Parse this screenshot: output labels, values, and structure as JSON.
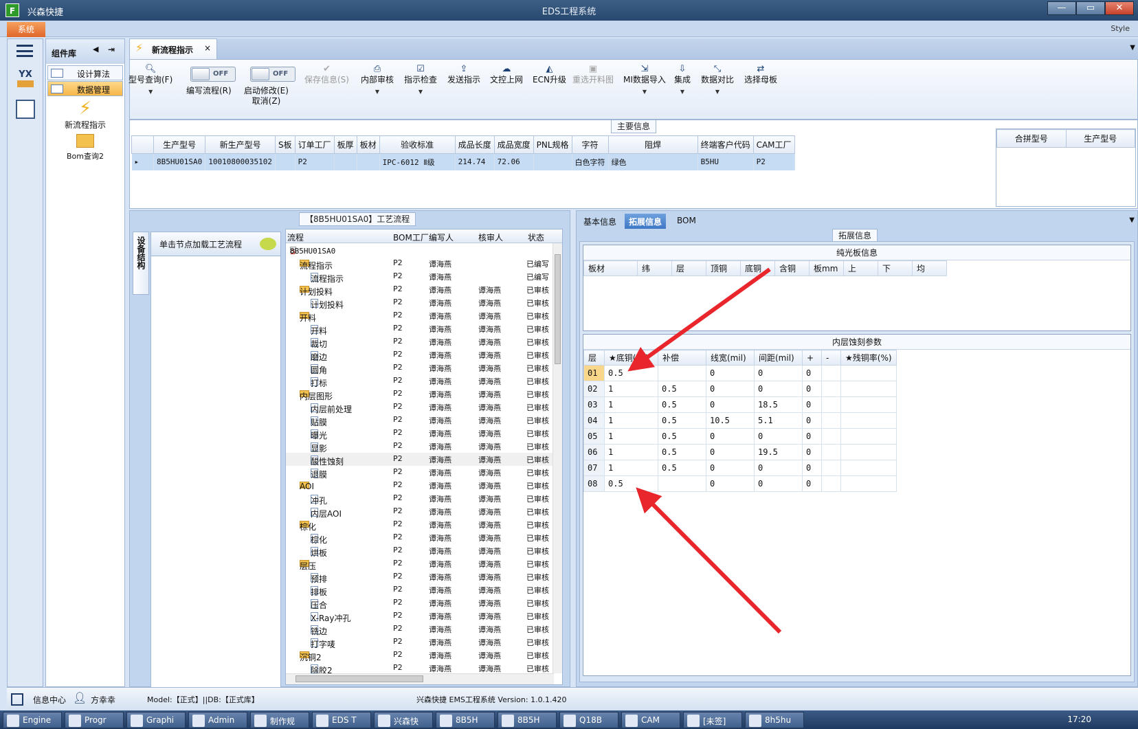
{
  "window": {
    "app_icon": "F",
    "app_name": "兴森快捷",
    "title": "EDS工程系统",
    "buttons": {
      "min": "—",
      "max": "▭",
      "close": "✕"
    }
  },
  "menu": {
    "system": "系统",
    "style": "Style"
  },
  "component_lib": {
    "title": "组件库",
    "items": [
      "设计算法",
      "数据管理"
    ],
    "tiles": [
      "新流程指示",
      "Bom查询2"
    ]
  },
  "doc_tab": {
    "label": "新流程指示",
    "close": "×"
  },
  "ribbon": {
    "query": "型号查询(F)",
    "write_flow": "编写流程(R)",
    "toggle_off": "OFF",
    "start_modify": "启动修改(E)",
    "cancel": "取消(Z)",
    "save": "保存信息(S)",
    "internal_review": "内部审核",
    "instruction_check": "指示检查",
    "send_instruction": "发送指示",
    "upload": "文控上网",
    "ecn": "ECN升级",
    "reselect": "重选开料图",
    "mi_import": "MI数据导入",
    "integrate": "集成",
    "compare": "数据对比",
    "mother_board": "选择母板"
  },
  "main_info": {
    "caption": "主要信息",
    "columns": [
      "生产型号",
      "新生产型号",
      "S板",
      "订单工厂",
      "板厚",
      "板材",
      "验收标准",
      "成品长度",
      "成品宽度",
      "PNL规格",
      "字符",
      "阻焊",
      "终端客户代码",
      "CAM工厂"
    ],
    "row": [
      "8B5HU01SA0",
      "10010800035102",
      "",
      "P2",
      "",
      "",
      "IPC-6012 Ⅱ级",
      "214.74",
      "72.06",
      "",
      "白色字符",
      "绿色",
      "B5HU",
      "P2"
    ],
    "side_columns": [
      "合拼型号",
      "生产型号"
    ]
  },
  "flow_panel": {
    "caption": "【8B5HU01SA0】工艺流程",
    "vertical_tab": "设备结构",
    "load_hint": "单击节点加载工艺流程",
    "headers": [
      "流程",
      "BOM工厂",
      "编写人",
      "核审人",
      "状态"
    ],
    "root": "8B5HU01SA0",
    "rows": [
      {
        "name": "流程指示",
        "level": 1,
        "folder": true,
        "bom": "P2",
        "writer": "谭海燕",
        "reviewer": "",
        "status": "已编写"
      },
      {
        "name": "流程指示",
        "level": 2,
        "folder": false,
        "bom": "P2",
        "writer": "谭海燕",
        "reviewer": "",
        "status": "已编写"
      },
      {
        "name": "计划投料",
        "level": 1,
        "folder": true,
        "bom": "P2",
        "writer": "谭海燕",
        "reviewer": "谭海燕",
        "status": "已审核"
      },
      {
        "name": "计划投料",
        "level": 2,
        "folder": false,
        "bom": "P2",
        "writer": "谭海燕",
        "reviewer": "谭海燕",
        "status": "已审核"
      },
      {
        "name": "开料",
        "level": 1,
        "folder": true,
        "bom": "P2",
        "writer": "谭海燕",
        "reviewer": "谭海燕",
        "status": "已审核"
      },
      {
        "name": "开料",
        "level": 2,
        "folder": false,
        "bom": "P2",
        "writer": "谭海燕",
        "reviewer": "谭海燕",
        "status": "已审核"
      },
      {
        "name": "裁切",
        "level": 2,
        "folder": false,
        "bom": "P2",
        "writer": "谭海燕",
        "reviewer": "谭海燕",
        "status": "已审核"
      },
      {
        "name": "磨边",
        "level": 2,
        "folder": false,
        "bom": "P2",
        "writer": "谭海燕",
        "reviewer": "谭海燕",
        "status": "已审核"
      },
      {
        "name": "圆角",
        "level": 2,
        "folder": false,
        "bom": "P2",
        "writer": "谭海燕",
        "reviewer": "谭海燕",
        "status": "已审核"
      },
      {
        "name": "打标",
        "level": 2,
        "folder": false,
        "bom": "P2",
        "writer": "谭海燕",
        "reviewer": "谭海燕",
        "status": "已审核"
      },
      {
        "name": "内层图形",
        "level": 1,
        "folder": true,
        "bom": "P2",
        "writer": "谭海燕",
        "reviewer": "谭海燕",
        "status": "已审核"
      },
      {
        "name": "内层前处理",
        "level": 2,
        "folder": false,
        "bom": "P2",
        "writer": "谭海燕",
        "reviewer": "谭海燕",
        "status": "已审核"
      },
      {
        "name": "贴膜",
        "level": 2,
        "folder": false,
        "bom": "P2",
        "writer": "谭海燕",
        "reviewer": "谭海燕",
        "status": "已审核"
      },
      {
        "name": "曝光",
        "level": 2,
        "folder": false,
        "bom": "P2",
        "writer": "谭海燕",
        "reviewer": "谭海燕",
        "status": "已审核"
      },
      {
        "name": "显影",
        "level": 2,
        "folder": false,
        "bom": "P2",
        "writer": "谭海燕",
        "reviewer": "谭海燕",
        "status": "已审核"
      },
      {
        "name": "酸性蚀刻",
        "level": 2,
        "folder": false,
        "bom": "P2",
        "writer": "谭海燕",
        "reviewer": "谭海燕",
        "status": "已审核",
        "highlight": true
      },
      {
        "name": "退膜",
        "level": 2,
        "folder": false,
        "bom": "P2",
        "writer": "谭海燕",
        "reviewer": "谭海燕",
        "status": "已审核"
      },
      {
        "name": "AOI",
        "level": 1,
        "folder": true,
        "bom": "P2",
        "writer": "谭海燕",
        "reviewer": "谭海燕",
        "status": "已审核"
      },
      {
        "name": "冲孔",
        "level": 2,
        "folder": false,
        "bom": "P2",
        "writer": "谭海燕",
        "reviewer": "谭海燕",
        "status": "已审核"
      },
      {
        "name": "内层AOI",
        "level": 2,
        "folder": false,
        "bom": "P2",
        "writer": "谭海燕",
        "reviewer": "谭海燕",
        "status": "已审核"
      },
      {
        "name": "棕化",
        "level": 1,
        "folder": true,
        "bom": "P2",
        "writer": "谭海燕",
        "reviewer": "谭海燕",
        "status": "已审核"
      },
      {
        "name": "棕化",
        "level": 2,
        "folder": false,
        "bom": "P2",
        "writer": "谭海燕",
        "reviewer": "谭海燕",
        "status": "已审核"
      },
      {
        "name": "烘板",
        "level": 2,
        "folder": false,
        "bom": "P2",
        "writer": "谭海燕",
        "reviewer": "谭海燕",
        "status": "已审核"
      },
      {
        "name": "层压",
        "level": 1,
        "folder": true,
        "bom": "P2",
        "writer": "谭海燕",
        "reviewer": "谭海燕",
        "status": "已审核"
      },
      {
        "name": "预排",
        "level": 2,
        "folder": false,
        "bom": "P2",
        "writer": "谭海燕",
        "reviewer": "谭海燕",
        "status": "已审核"
      },
      {
        "name": "排板",
        "level": 2,
        "folder": false,
        "bom": "P2",
        "writer": "谭海燕",
        "reviewer": "谭海燕",
        "status": "已审核"
      },
      {
        "name": "压合",
        "level": 2,
        "folder": false,
        "bom": "P2",
        "writer": "谭海燕",
        "reviewer": "谭海燕",
        "status": "已审核"
      },
      {
        "name": "X-Ray冲孔",
        "level": 2,
        "folder": false,
        "bom": "P2",
        "writer": "谭海燕",
        "reviewer": "谭海燕",
        "status": "已审核"
      },
      {
        "name": "铣边",
        "level": 2,
        "folder": false,
        "bom": "P2",
        "writer": "谭海燕",
        "reviewer": "谭海燕",
        "status": "已审核"
      },
      {
        "name": "打字唛",
        "level": 2,
        "folder": false,
        "bom": "P2",
        "writer": "谭海燕",
        "reviewer": "谭海燕",
        "status": "已审核"
      },
      {
        "name": "沉铜2",
        "level": 1,
        "folder": true,
        "bom": "P2",
        "writer": "谭海燕",
        "reviewer": "谭海燕",
        "status": "已审核"
      },
      {
        "name": "除胶2",
        "level": 2,
        "folder": false,
        "bom": "P2",
        "writer": "谭海燕",
        "reviewer": "谭海燕",
        "status": "已审核"
      }
    ]
  },
  "right_tabs": [
    "基本信息",
    "拓展信息",
    "BOM"
  ],
  "ext_info": {
    "caption": "拓展信息",
    "plain_board": {
      "title": "纯光板信息",
      "columns": [
        "板材",
        "纬",
        "层",
        "顶铜",
        "底铜",
        "含铜",
        "板mm",
        "上",
        "下",
        "均"
      ]
    },
    "inner_etch": {
      "title": "内层蚀刻参数",
      "columns": [
        "层",
        "★底铜(oz)",
        "补偿",
        "线宽(mil)",
        "间距(mil)",
        "+",
        "-",
        "★残铜率(%)"
      ],
      "rows": [
        [
          "01",
          "0.5",
          "",
          "0",
          "0",
          "0",
          "",
          ""
        ],
        [
          "02",
          "1",
          "0.5",
          "0",
          "0",
          "0",
          "",
          ""
        ],
        [
          "03",
          "1",
          "0.5",
          "0",
          "18.5",
          "0",
          "",
          ""
        ],
        [
          "04",
          "1",
          "0.5",
          "10.5",
          "5.1",
          "0",
          "",
          ""
        ],
        [
          "05",
          "1",
          "0.5",
          "0",
          "0",
          "0",
          "",
          ""
        ],
        [
          "06",
          "1",
          "0.5",
          "0",
          "19.5",
          "0",
          "",
          ""
        ],
        [
          "07",
          "1",
          "0.5",
          "0",
          "0",
          "0",
          "",
          ""
        ],
        [
          "08",
          "0.5",
          "",
          "0",
          "0",
          "0",
          "",
          ""
        ]
      ]
    }
  },
  "status": {
    "info_center": "信息中心",
    "user": "方幸幸",
    "model": "Model:【正式】||DB:【正式库】",
    "version": "兴森快捷 EMS工程系统 Version: 1.0.1.420"
  },
  "taskbar": {
    "items": [
      "Engine",
      "Progr",
      "Graphi",
      "Admin",
      "制作规",
      "EDS T",
      "兴森快",
      "8B5H",
      "8B5H",
      "Q18B",
      "CAM",
      "[未签]",
      "8h5hu"
    ],
    "time": "17:20"
  },
  "colors": {
    "accent": "#3e78c6",
    "arrow": "#e8262c",
    "system_tab": "#e0662a"
  }
}
